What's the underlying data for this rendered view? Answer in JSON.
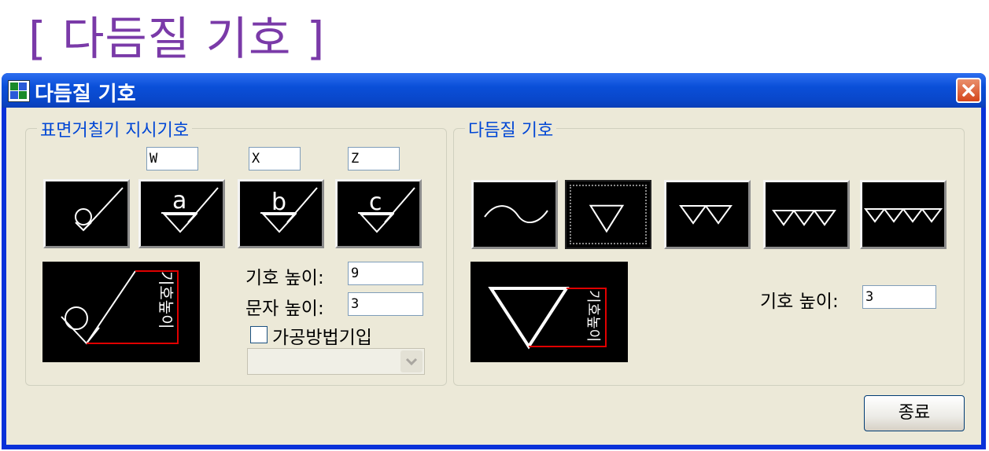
{
  "page": {
    "heading": "[ 다듬질 기호 ]"
  },
  "window": {
    "title": "다듬질 기호",
    "app_icon": "app-icon",
    "close_icon": "close-icon"
  },
  "left_group": {
    "title": "표면거칠기 지시기호",
    "inputs": {
      "w": "W",
      "x": "X",
      "z": "Z"
    },
    "symbol_buttons": [
      {
        "id": "basic",
        "letter": ""
      },
      {
        "id": "a",
        "letter": "a"
      },
      {
        "id": "b",
        "letter": "b"
      },
      {
        "id": "c",
        "letter": "c"
      }
    ],
    "preview_label": "기호높이",
    "symbol_height_label": "기호 높이:",
    "symbol_height_value": "9",
    "text_height_label": "문자 높이:",
    "text_height_value": "3",
    "checkbox_label": "가공방법기입",
    "checkbox_checked": false,
    "combo_value": ""
  },
  "right_group": {
    "title": "다듬질 기호",
    "symbol_buttons": [
      {
        "id": "wave",
        "triangles": 0
      },
      {
        "id": "one",
        "triangles": 1,
        "selected": true
      },
      {
        "id": "two",
        "triangles": 2
      },
      {
        "id": "three",
        "triangles": 3
      },
      {
        "id": "four",
        "triangles": 4
      }
    ],
    "preview_label": "기호높이",
    "symbol_height_label": "기호 높이:",
    "symbol_height_value": "3"
  },
  "footer": {
    "close_label": "종료"
  },
  "colors": {
    "heading": "#7a3aa8",
    "group_title": "#0046d5",
    "titlebar": "#0a4fd8",
    "marker_red": "#e00000"
  }
}
